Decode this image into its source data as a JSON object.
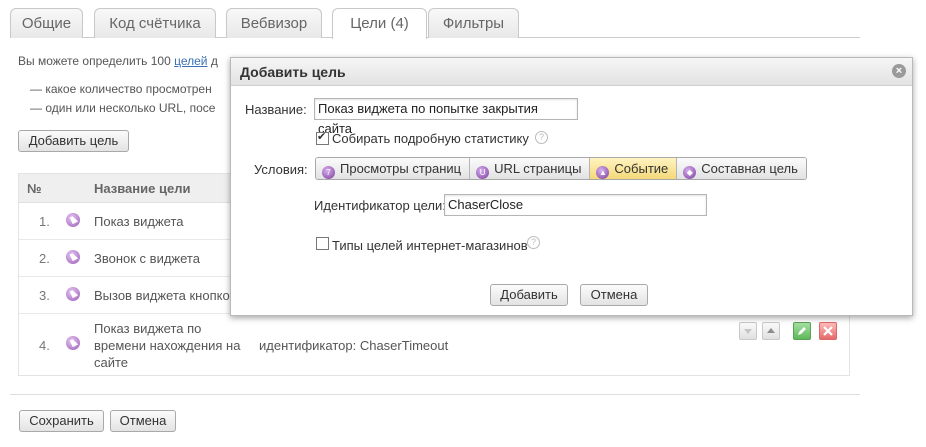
{
  "tabs": [
    {
      "label": "Общие"
    },
    {
      "label": "Код счётчика"
    },
    {
      "label": "Вебвизор"
    },
    {
      "label": "Цели (4)"
    },
    {
      "label": "Фильтры"
    }
  ],
  "intro": {
    "prefix": "Вы можете определить 100 ",
    "link": "целей",
    "suffix": " д",
    "bullets": [
      "— какое количество просмотрен",
      "— один или несколько URL, посе"
    ]
  },
  "add_goal_button": "Добавить цель",
  "table": {
    "headers": {
      "num": "№",
      "name": "Название цели"
    },
    "rows": [
      {
        "num": "1.",
        "name": "Показ виджета",
        "id": ""
      },
      {
        "num": "2.",
        "name": "Звонок с виджета",
        "id": ""
      },
      {
        "num": "3.",
        "name": "Вызов виджета кнопко",
        "id": ""
      },
      {
        "num": "4.",
        "name_lines": [
          "Показ виджета по",
          "времени нахождения на",
          "сайте"
        ],
        "id": "идентификатор: ChaserTimeout"
      }
    ]
  },
  "footer": {
    "save": "Сохранить",
    "cancel": "Отмена"
  },
  "dialog": {
    "title": "Добавить цель",
    "name_label": "Название:",
    "name_value": "Показ виджета по попытке закрытия сайта",
    "detailed_stats": "Собирать подробную статистику",
    "detailed_stats_checked": true,
    "conditions_label": "Условия:",
    "condition_types": [
      {
        "label": "Просмотры страниц",
        "icon": "page-views-icon"
      },
      {
        "label": "URL страницы",
        "icon": "url-icon"
      },
      {
        "label": "Событие",
        "icon": "event-icon",
        "selected": true
      },
      {
        "label": "Составная цель",
        "icon": "composite-icon"
      }
    ],
    "goal_id_label": "Идентификатор цели:",
    "goal_id_value": "ChaserClose",
    "ecommerce_types": "Типы целей интернет-магазинов",
    "ecommerce_checked": false,
    "add_button": "Добавить",
    "cancel_button": "Отмена",
    "help_glyph": "?",
    "close_glyph": "×"
  },
  "colors": {
    "selected_segment": "#f4d97a",
    "goal_icon": "#9a5ab8",
    "link": "#3a6fb5"
  }
}
